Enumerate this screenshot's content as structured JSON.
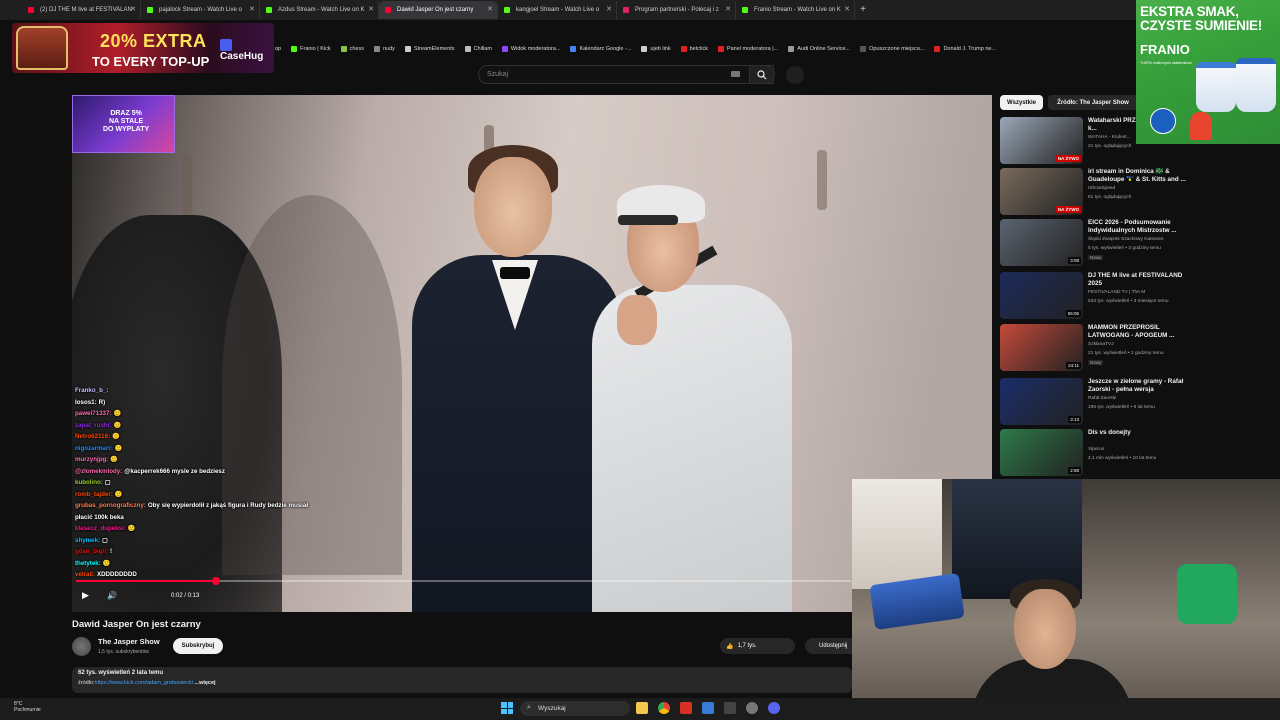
{
  "browser": {
    "tabs": [
      {
        "label": "(2) DJ THE M live at FESTIVALAN",
        "color": "#ff0033"
      },
      {
        "label": "pajalock Stream - Watch Live o",
        "color": "#53fc18"
      },
      {
        "label": "Azdus Stream - Watch Live on K",
        "color": "#53fc18"
      },
      {
        "label": "Dawid Jasper On jest czarny",
        "color": "#ff0033",
        "active": true
      },
      {
        "label": "kangjoel Stream - Watch Live o",
        "color": "#53fc18"
      },
      {
        "label": "Program partnerski - Polecaj i z",
        "color": "#e0245e"
      },
      {
        "label": "Franio Stream - Watch Live on K",
        "color": "#53fc18"
      }
    ],
    "new_tab": "+",
    "close_glyph": "✕",
    "bookmarks": [
      {
        "label": "Franio | Kick",
        "color": "#53fc18"
      },
      {
        "label": "chess",
        "color": "#8bc34a"
      },
      {
        "label": "nudy",
        "color": "#888888"
      },
      {
        "label": "StreamElements",
        "color": "#cccccc"
      },
      {
        "label": "Chillam",
        "color": "#bbbbbb"
      },
      {
        "label": "Widok moderatora...",
        "color": "#9146ff"
      },
      {
        "label": "Kalendarz Google -...",
        "color": "#4285f4"
      },
      {
        "label": "ujeb link",
        "color": "#cccccc"
      },
      {
        "label": "betclick",
        "color": "#e02020"
      },
      {
        "label": "Panel moderatora |...",
        "color": "#e02020"
      },
      {
        "label": "Audi Online Service...",
        "color": "#999999"
      },
      {
        "label": "Opuszczone miejsca...",
        "color": "#555555"
      },
      {
        "label": "Donald J. Trump ne...",
        "color": "#e02020"
      }
    ],
    "bookmark_prefix": "op"
  },
  "ads": {
    "casehug": {
      "line1": "20% EXTRA",
      "line2": "TO EVERY TOP-UP",
      "brand": "CaseHug"
    },
    "video_ad": {
      "line1": "DRAZ 5%",
      "line2": "NA STALE",
      "line3": "DO WYPLATY"
    },
    "icecream": {
      "line1": "EKSTRA SMAK,",
      "line2": "CZYSTE SUMIENIE!",
      "brand": "FRANIO",
      "small": "*100% roślinnych składników"
    }
  },
  "search": {
    "placeholder": "Szukaj"
  },
  "chat": [
    {
      "user": "Franko_b_:",
      "text": "",
      "color": "#c0c0ff"
    },
    {
      "user": "losos1:",
      "text": "R)",
      "color": "#ffffff"
    },
    {
      "user": "pawel71337:",
      "text": "🙂",
      "color": "#ff69b4"
    },
    {
      "user": "zapat_rushi:",
      "text": "🙂",
      "color": "#8a2be2"
    },
    {
      "user": "Netro62116:",
      "text": "🙂",
      "color": "#ff4500"
    },
    {
      "user": "nigozarmarr:",
      "text": "🙂",
      "color": "#1e90ff"
    },
    {
      "user": "murzynjpg:",
      "text": "🙂",
      "color": "#ff69b4"
    },
    {
      "user": "@zlomekmlody:",
      "text": "@kacperrek666 mysle ze bedziesz",
      "color": "#ff69b4"
    },
    {
      "user": "kubolino:",
      "text": "▢",
      "color": "#9acd32"
    },
    {
      "user": "romb_tajder:",
      "text": "🙂",
      "color": "#ff4500"
    },
    {
      "user": "grubas_pornograficzny:",
      "text": "Oby się wypierdolił z jakąś figura i Rudy bedzie musiał",
      "color": "#ff7f50"
    },
    {
      "user": "płacić 100k beka",
      "text": "",
      "color": "#ffffff"
    },
    {
      "user": "klasecz_dupeksi:",
      "text": "🙂",
      "color": "#ff1493"
    },
    {
      "user": "shymek:",
      "text": "▢",
      "color": "#00bfff"
    },
    {
      "user": "gdan_bigii:",
      "text": "!",
      "color": "#ff0000"
    },
    {
      "user": "thetytek:",
      "text": "🙂",
      "color": "#00ffff"
    },
    {
      "user": "velrail:",
      "text": "XDDDDDDDD",
      "color": "#ff4500"
    }
  ],
  "player": {
    "time_current": "0:02",
    "time_total": "0:13",
    "time_label": "0:02 / 0:13",
    "progress": 0.18,
    "play_glyph": "▶",
    "volume_glyph": "🔊"
  },
  "video": {
    "title": "Dawid Jasper On jest czarny",
    "channel": "The Jasper Show",
    "subscribers": "1,5 tys. subskrybentów",
    "subscribe_label": "Subskrybuj",
    "likes": "1,7 tys.",
    "like_glyph": "👍",
    "share_label": "Udostępnij",
    "views_line": "62 tys. wyświetleń  2 lata temu",
    "source_prefix": "źródło:",
    "source_link": "https://www.kick.com/adam_grabowiecki",
    "more": "...więcej"
  },
  "sidebar": {
    "chips": [
      "Wszystkie",
      "Źródło: The Jasper Show"
    ],
    "items": [
      {
        "title": "Wataharski PRZ... (Latwogang - k...",
        "channel": "WATAHA - Krulest...",
        "meta": "21 tys. oglądających",
        "badge": "NA ŻYWO",
        "live": true,
        "thumb": "#9aa7b8"
      },
      {
        "title": "irl stream in Dominica 🇩🇲 & Guadeloupe 🇬🇵 & St. Kitts and ...",
        "channel": "IShowSpeed",
        "meta": "61 tys. oglądających",
        "badge": "NA ŻYWO",
        "live": true,
        "thumb": "#7a6b5c"
      },
      {
        "title": "EICC 2026 - Podsumowanie Indywidualnych Mistrzostw ...",
        "channel": "Śląski Związek Szachowy Katowice",
        "meta": "5 tys. wyświetleń • 2 godziny temu",
        "new": "Nowy",
        "badge": "3:08",
        "live": false,
        "thumb": "#5a6470"
      },
      {
        "title": "DJ THE M live at FESTIVALAND 2025",
        "channel": "FESTIVALAND TV | The M",
        "meta": "633 tys. wyświetleń • 3 miesiące temu",
        "badge": "55:05",
        "live": false,
        "thumb": "#1b2a5a"
      },
      {
        "title": "MAMMON PRZEPROSIL LATWOGANG - APOGEUM ...",
        "channel": "SzklanaTVJ",
        "meta": "21 tys. wyświetleń • 2 godziny temu",
        "new": "Nowy",
        "badge": "24:11",
        "live": false,
        "thumb": "#c44a3a"
      },
      {
        "title": "Jeszcze w zielone gramy - Rafał Zaorski - pełna wersja",
        "channel": "Rafał Zaorski",
        "meta": "196 tys. wyświetleń • 6 lat temu",
        "badge": "3:13",
        "live": false,
        "thumb": "#1a2d6a"
      },
      {
        "title": "Dis vs donejty",
        "channel": "Viperus",
        "meta": "2,1 mln wyświetleń • 10 lat temu",
        "badge": "2:58",
        "live": false,
        "thumb": "#2e7a4a"
      }
    ]
  },
  "taskbar": {
    "weather_temp": "8°C",
    "weather_desc": "Pochmurnie",
    "search_label": "Wyszukaj",
    "search_glyph": "⌕"
  },
  "colors": {
    "accent": "#ff0033",
    "bg": "#0f0f0f",
    "kick": "#53fc18"
  }
}
